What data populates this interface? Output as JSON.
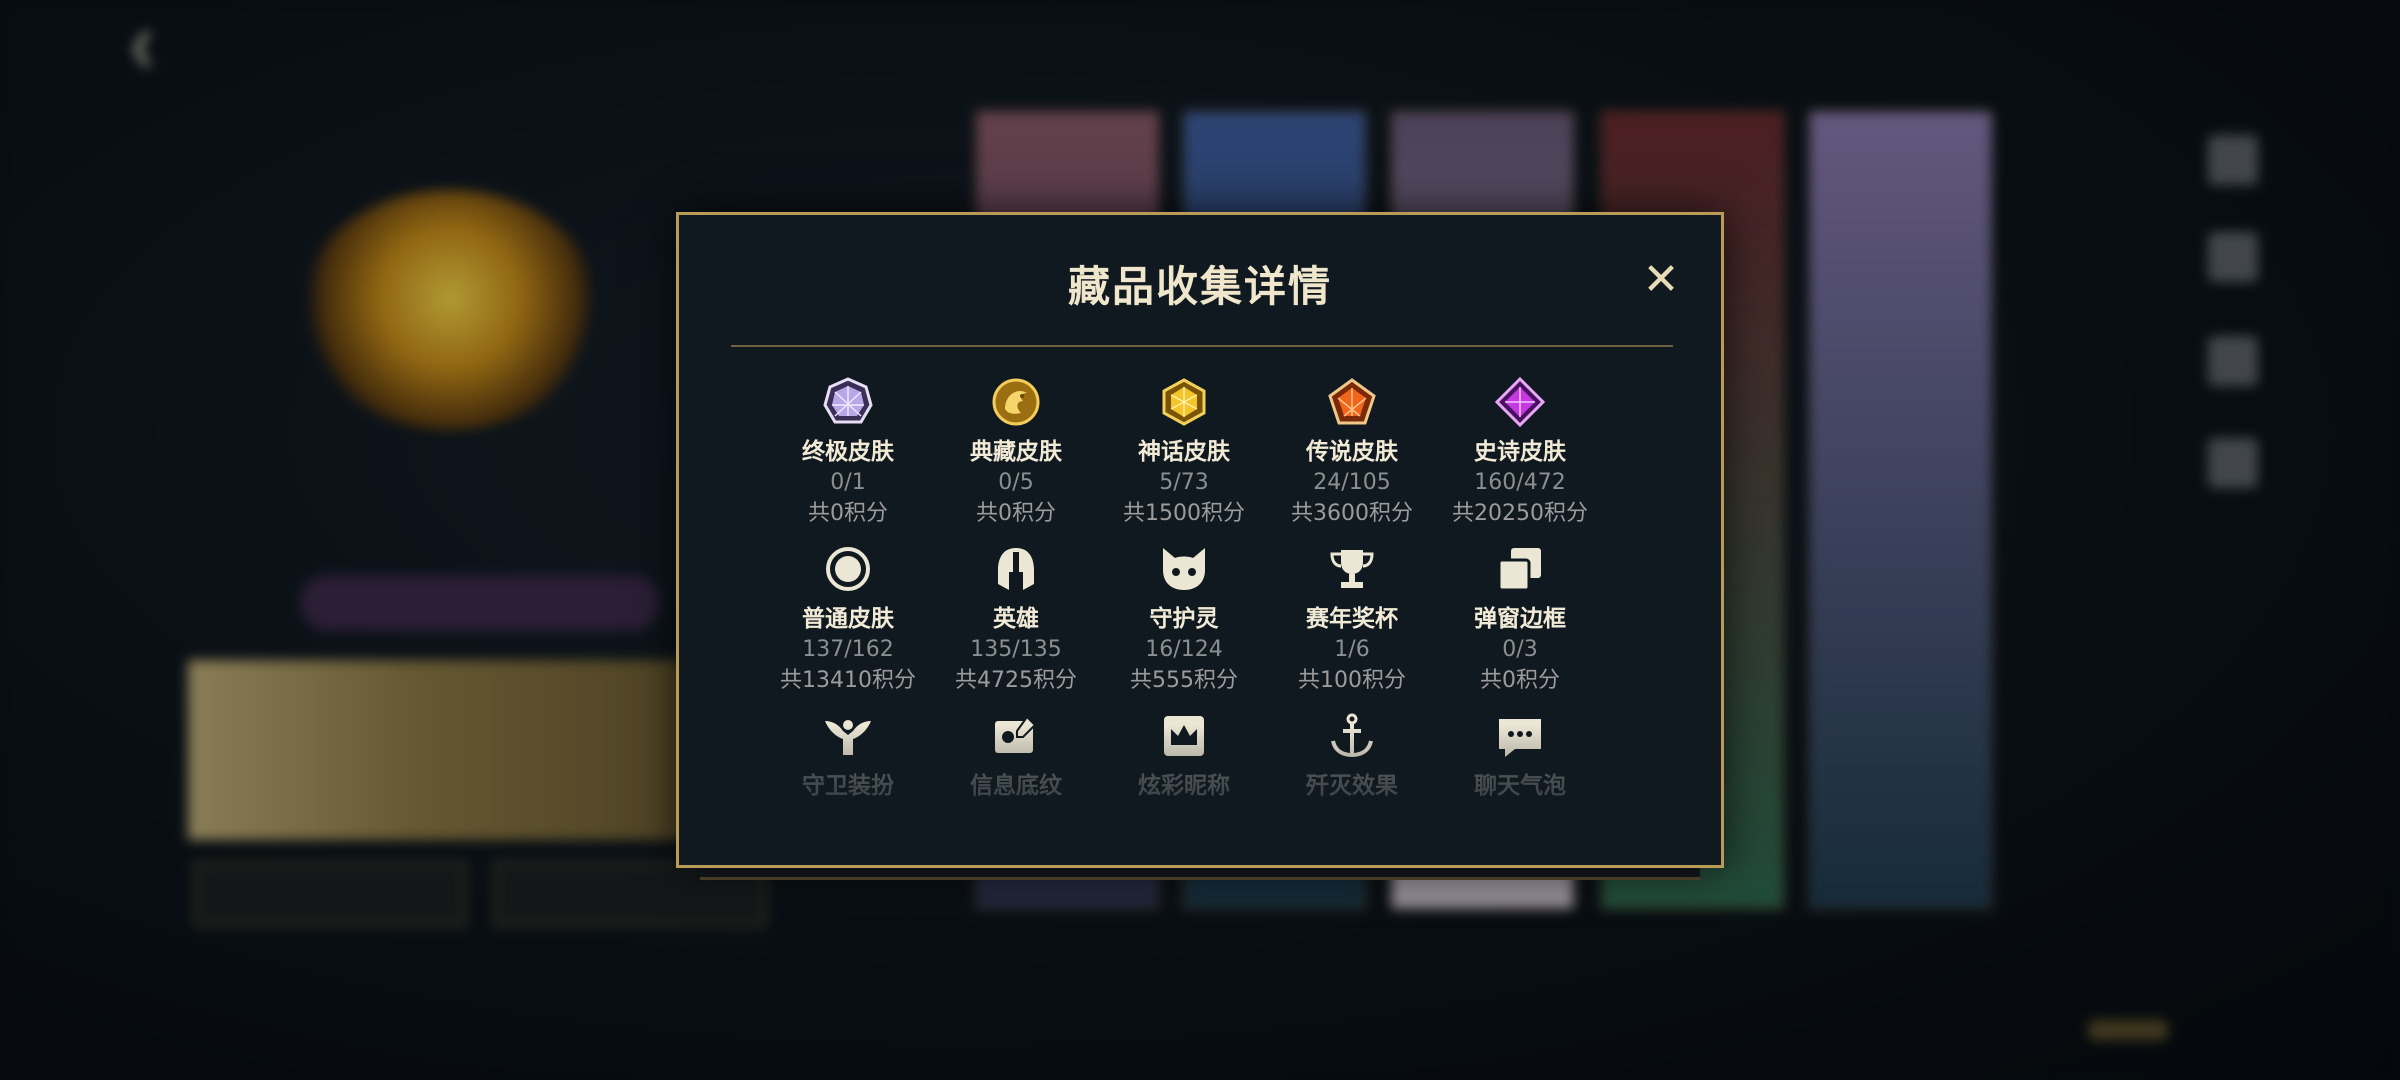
{
  "modal": {
    "title": "藏品收集详情",
    "close_glyph": "✕",
    "items": [
      {
        "label": "终极皮肤",
        "count": "0/1",
        "points": "共0积分",
        "icon": "ultimate-gem-icon"
      },
      {
        "label": "典藏皮肤",
        "count": "0/5",
        "points": "共0积分",
        "icon": "collection-dragon-icon"
      },
      {
        "label": "神话皮肤",
        "count": "5/73",
        "points": "共1500积分",
        "icon": "mythic-gem-icon"
      },
      {
        "label": "传说皮肤",
        "count": "24/105",
        "points": "共3600积分",
        "icon": "legendary-gem-icon"
      },
      {
        "label": "史诗皮肤",
        "count": "160/472",
        "points": "共20250积分",
        "icon": "epic-gem-icon"
      },
      {
        "label": "普通皮肤",
        "count": "137/162",
        "points": "共13410积分",
        "icon": "circle-icon"
      },
      {
        "label": "英雄",
        "count": "135/135",
        "points": "共4725积分",
        "icon": "helmet-icon"
      },
      {
        "label": "守护灵",
        "count": "16/124",
        "points": "共555积分",
        "icon": "cat-face-icon"
      },
      {
        "label": "赛年奖杯",
        "count": "1/6",
        "points": "共100积分",
        "icon": "trophy-icon"
      },
      {
        "label": "弹窗边框",
        "count": "0/3",
        "points": "共0积分",
        "icon": "frames-icon"
      },
      {
        "label": "守卫装扮",
        "icon": "ward-icon"
      },
      {
        "label": "信息底纹",
        "icon": "card-edit-icon"
      },
      {
        "label": "炫彩昵称",
        "icon": "crown-card-icon"
      },
      {
        "label": "歼灭效果",
        "icon": "anchor-icon"
      },
      {
        "label": "聊天气泡",
        "icon": "chat-bubble-icon"
      }
    ]
  },
  "colors": {
    "accent_gold": "#b99a57",
    "title_text": "#efe6cc",
    "muted_text": "#8c8f90"
  }
}
